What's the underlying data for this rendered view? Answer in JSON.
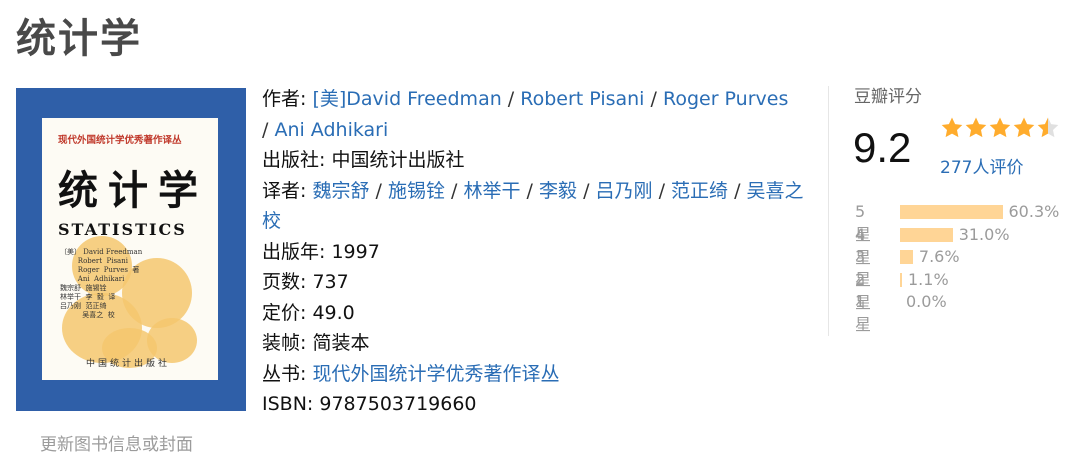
{
  "page": {
    "title": "统计学"
  },
  "cover": {
    "series": "现代外国统计学优秀著作译丛",
    "title_cn": "统计学",
    "title_en": "STATISTICS",
    "authors_block": "〔美〕 David Freedman\n        Robert  Pisani\n        Roger  Purves  著\n        Ani  Adhikari\n魏宗舒  施锡铨\n林举干  李  毅  译\n吕乃刚  范正绮\n          吴喜之  校",
    "publisher": "中国统计出版社",
    "update_link": "更新图书信息或封面"
  },
  "info": {
    "author_label": "作者:",
    "authors": [
      "[美]David Freedman",
      "Robert Pisani",
      "Roger Purves",
      "Ani Adhikari"
    ],
    "publisher_label": "出版社:",
    "publisher": "中国统计出版社",
    "translator_label": "译者:",
    "translators": [
      "魏宗舒",
      "施锡铨",
      "林举干",
      "李毅",
      "吕乃刚",
      "范正绮",
      "吴喜之 校"
    ],
    "year_label": "出版年:",
    "year": "1997",
    "pages_label": "页数:",
    "pages": "737",
    "price_label": "定价:",
    "price": "49.0",
    "binding_label": "装帧:",
    "binding": "简装本",
    "series_label": "丛书:",
    "series": "现代外国统计学优秀著作译丛",
    "isbn_label": "ISBN:",
    "isbn": "9787503719660"
  },
  "rating": {
    "title": "豆瓣评分",
    "score": "9.2",
    "stars_value": 4.5,
    "votes": "277人评价",
    "star_color": "#ffac2d",
    "distribution": [
      {
        "label": "5星",
        "percent": 60.3,
        "text": "60.3%"
      },
      {
        "label": "4星",
        "percent": 31.0,
        "text": "31.0%"
      },
      {
        "label": "3星",
        "percent": 7.6,
        "text": "7.6%"
      },
      {
        "label": "2星",
        "percent": 1.1,
        "text": "1.1%"
      },
      {
        "label": "1星",
        "percent": 0.0,
        "text": "0.0%"
      }
    ]
  }
}
